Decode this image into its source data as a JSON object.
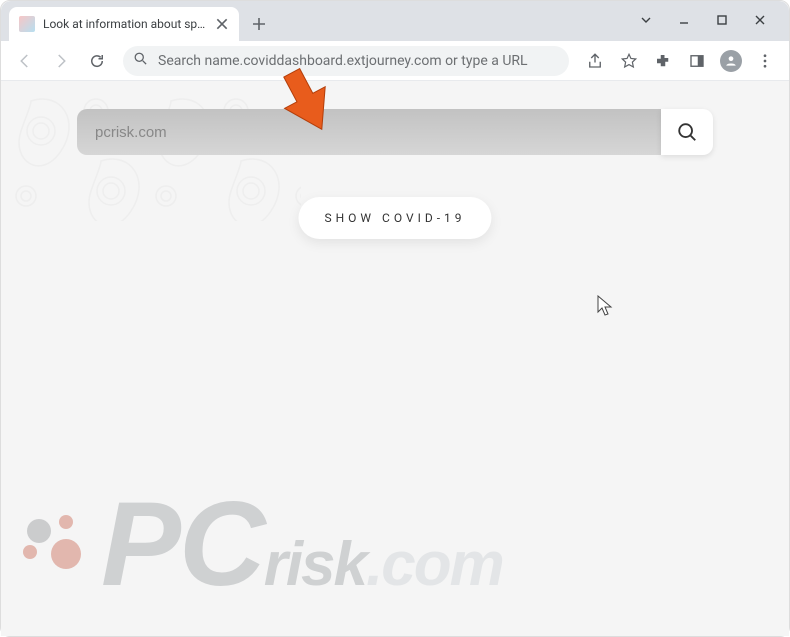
{
  "tab": {
    "title": "Look at information about spread"
  },
  "omnibox": {
    "text": "Search name.coviddashboard.extjourney.com or type a URL"
  },
  "page": {
    "search_placeholder": "pcrisk.com",
    "show_button": "SHOW COVID-19"
  },
  "watermark": {
    "pc": "PC",
    "rest": "risk",
    "suffix": ".com"
  }
}
